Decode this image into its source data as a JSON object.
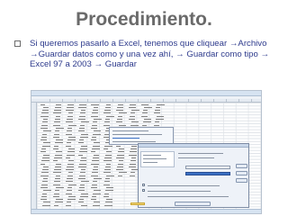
{
  "slide": {
    "title": "Procedimiento.",
    "bullet_text": "Si queremos pasarlo a Excel, tenemos que cliquear →Archivo →Guardar datos como y una vez ahí, → Guardar como tipo → Excel 97 a 2003 → Guardar"
  },
  "colors": {
    "title": "#6a6a6a",
    "bullet_text": "#2d3a8c",
    "excel_ribbon": "#d6e3f1",
    "dialog_highlight": "#3a6fc3"
  },
  "icons": {
    "bullet": "hollow-square-bullet"
  }
}
